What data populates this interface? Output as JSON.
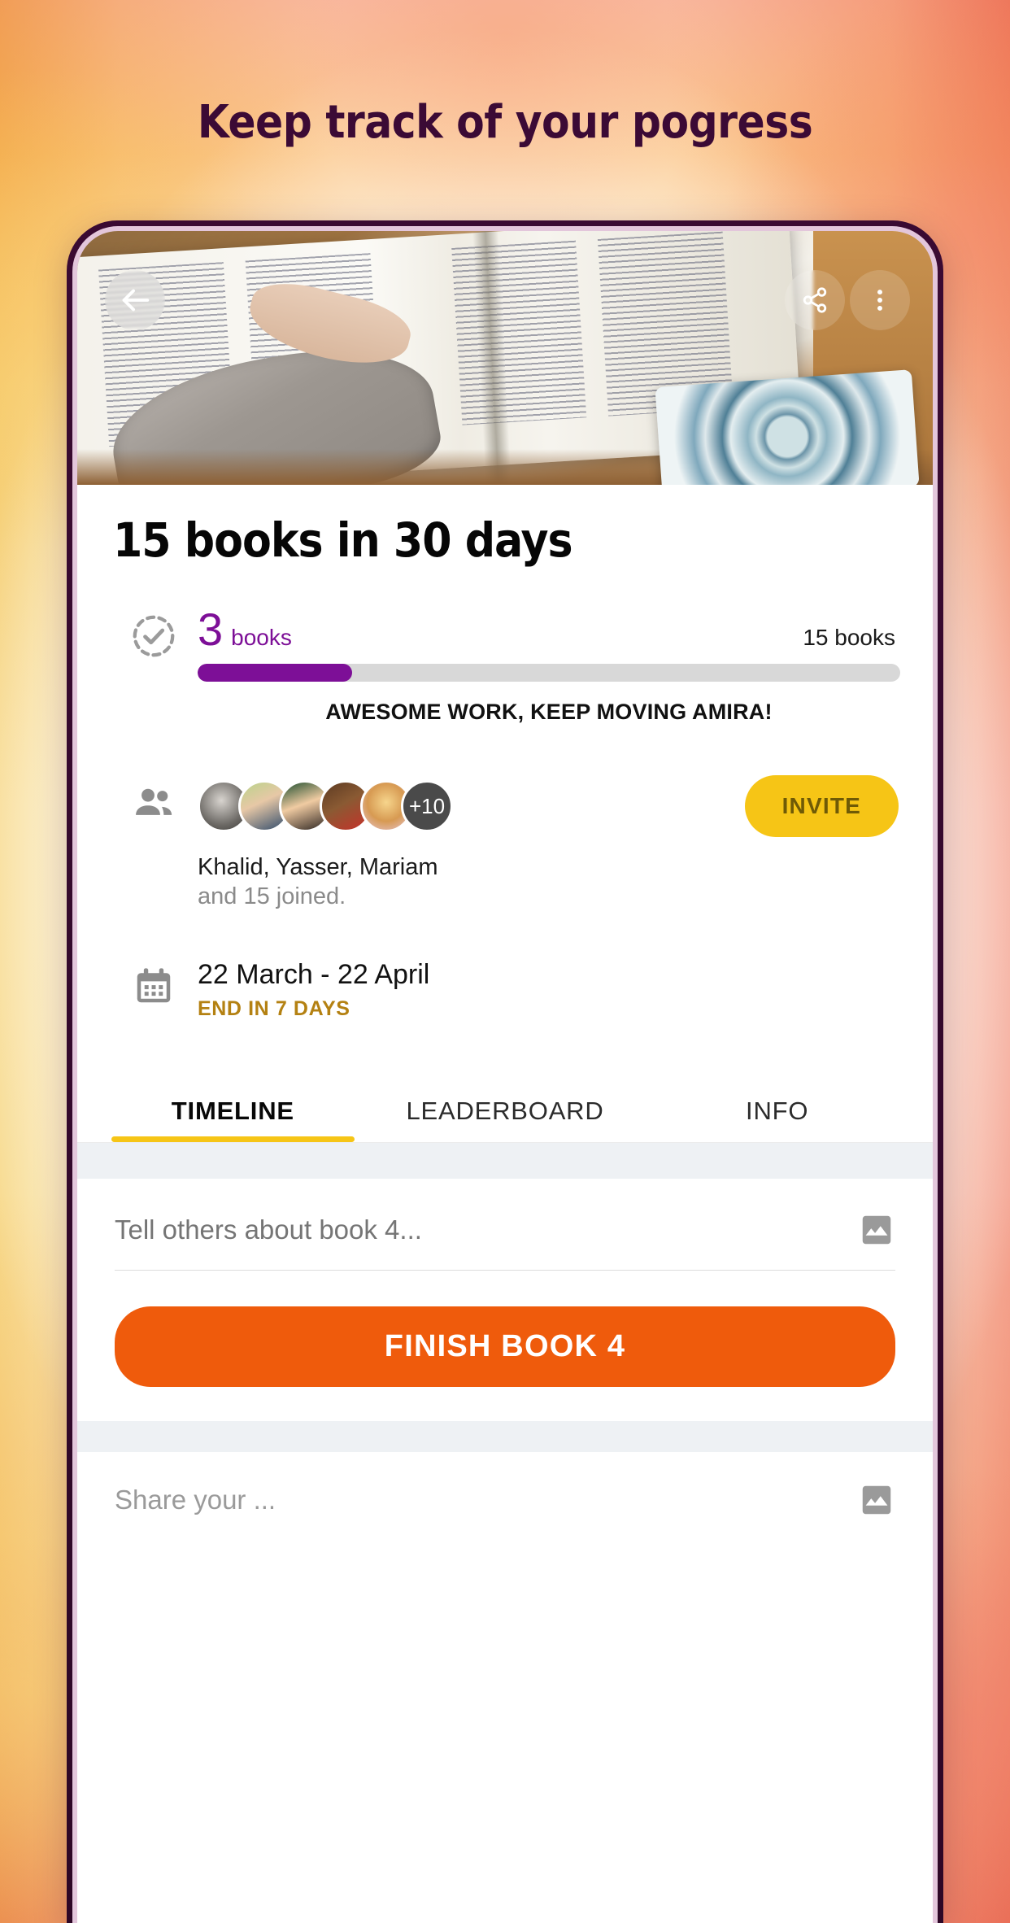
{
  "promo": {
    "headline": "Keep track of your pogress"
  },
  "appbar": {
    "back_icon": "arrow-left-icon",
    "share_icon": "share-icon",
    "overflow_icon": "more-vertical-icon"
  },
  "challenge": {
    "title": "15 books in 30 days",
    "progress": {
      "current_value": "3",
      "current_unit": "books",
      "total_label": "15 books",
      "percent": 22,
      "message": "AWESOME WORK, KEEP MOVING AMIRA!",
      "icon": "check-circle-dashed-icon",
      "fill_color": "#7d0f97",
      "track_color": "#d8d8d8"
    },
    "people": {
      "icon": "people-icon",
      "extra_count": "+10",
      "invite_label": "INVITE",
      "invite_color": "#f6c516",
      "names": "Khalid, Yasser, Mariam",
      "names_sub": "and 15 joined.",
      "avatars": [
        {
          "name": "avatar-1"
        },
        {
          "name": "avatar-2"
        },
        {
          "name": "avatar-3"
        },
        {
          "name": "avatar-4"
        },
        {
          "name": "avatar-5"
        }
      ]
    },
    "schedule": {
      "icon": "calendar-icon",
      "range": "22 March - 22 April",
      "remaining": "END IN 7 DAYS",
      "remaining_color": "#b48112"
    }
  },
  "tabs": [
    {
      "label": "TIMELINE",
      "active": true
    },
    {
      "label": "LEADERBOARD",
      "active": false
    },
    {
      "label": "INFO",
      "active": false
    }
  ],
  "compose": {
    "placeholder": "Tell others about book 4...",
    "image_icon": "image-icon",
    "finish_label": "FINISH BOOK 4",
    "finish_color": "#ef5b0c"
  },
  "next_post": {
    "placeholder": "Share your ...",
    "image_icon": "image-icon"
  }
}
